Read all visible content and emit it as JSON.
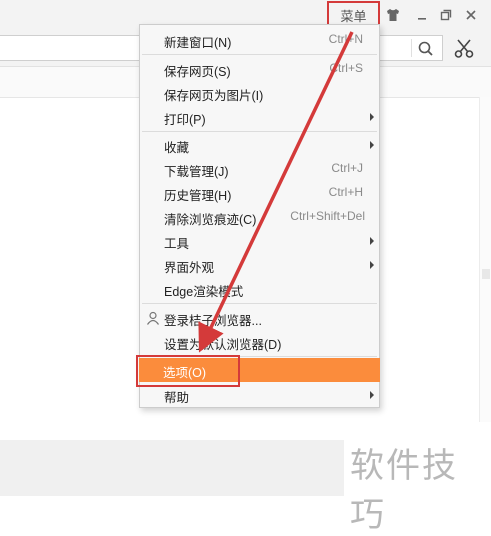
{
  "titlebar": {
    "menu_label": "菜单",
    "icons": [
      "skin-icon",
      "minimize-icon",
      "restore-icon",
      "close-icon"
    ]
  },
  "toolbar": {
    "search_icon": "search-icon",
    "cut_icon": "scissors-icon"
  },
  "menu": {
    "items": [
      {
        "label": "新建窗口(N)",
        "shortcut": "Ctrl+N"
      },
      {
        "label": "保存网页(S)",
        "shortcut": "Ctrl+S"
      },
      {
        "label": "保存网页为图片(I)",
        "shortcut": ""
      },
      {
        "label": "打印(P)",
        "shortcut": "",
        "submenu": true
      },
      {
        "label": "收藏",
        "shortcut": "",
        "submenu": true
      },
      {
        "label": "下载管理(J)",
        "shortcut": "Ctrl+J"
      },
      {
        "label": "历史管理(H)",
        "shortcut": "Ctrl+H"
      },
      {
        "label": "清除浏览痕迹(C)",
        "shortcut": "Ctrl+Shift+Del"
      },
      {
        "label": "工具",
        "shortcut": "",
        "submenu": true
      },
      {
        "label": "界面外观",
        "shortcut": "",
        "submenu": true
      },
      {
        "label": "Edge渲染模式",
        "shortcut": ""
      },
      {
        "label": "登录桔子浏览器...",
        "shortcut": "",
        "icon": "user-icon"
      },
      {
        "label": "设置为默认浏览器(D)",
        "shortcut": ""
      },
      {
        "label": "选项(O)",
        "shortcut": "",
        "selected": true
      },
      {
        "label": "帮助",
        "shortcut": "",
        "submenu": true
      }
    ]
  },
  "colors": {
    "highlight": "#fb8c3c",
    "annotation_red": "#d43a3a"
  },
  "watermark": "软件技巧"
}
